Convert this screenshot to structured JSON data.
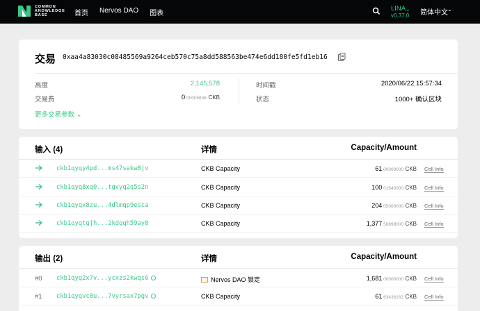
{
  "header": {
    "logo_lines": [
      "COMMON",
      "KNOWLEDGE",
      "BASE"
    ],
    "nav": [
      "首页",
      "Nervos DAO",
      "图表"
    ],
    "chain_name": "LINA",
    "chain_version": "v0.37.0",
    "language": "简体中文"
  },
  "transaction": {
    "title": "交易",
    "hash": "0xaa4a83030c08485569a9264ceb570c75a8dd588563be474e6dd180fe5fd1eb16",
    "height_label": "高度",
    "height_value": "2,145,578",
    "fee_label": "交易费",
    "fee_int": "0",
    "fee_dec": ".00005836",
    "fee_unit": "CKB",
    "timestamp_label": "时间戳",
    "timestamp_value": "2020/06/22 15:57:34",
    "status_label": "状态",
    "status_value": "1000+ 确认区块",
    "more_label": "更多交易参数"
  },
  "inputs": {
    "title": "输入 (4)",
    "detail_header": "详情",
    "amount_header": "Capacity/Amount",
    "rows": [
      {
        "address": "ckb1qyqy4pd...ms47sekw8jv",
        "detail": "CKB Capacity",
        "amount_int": "61",
        "amount_dec": ".00000000",
        "unit": "CKB",
        "cell_info": "Cell Info"
      },
      {
        "address": "ckb1qyq8xq0...tgvyq2q5s2n",
        "detail": "CKB Capacity",
        "amount_int": "100",
        "amount_dec": ".01543000",
        "unit": "CKB",
        "cell_info": "Cell Info"
      },
      {
        "address": "ckb1qyqx8zu...4dlmqp9esca",
        "detail": "CKB Capacity",
        "amount_int": "204",
        "amount_dec": ".05000000",
        "unit": "CKB",
        "cell_info": "Cell Info"
      },
      {
        "address": "ckb1qyqtgjh...2kdqqh59ay8",
        "detail": "CKB Capacity",
        "amount_int": "1,377",
        "amount_dec": ".56899000",
        "unit": "CKB",
        "cell_info": "Cell Info"
      }
    ]
  },
  "outputs": {
    "title": "输出 (2)",
    "detail_header": "详情",
    "amount_header": "Capacity/Amount",
    "rows": [
      {
        "index": "#0",
        "address": "ckb1qyq2x7v...ycxzs2kwqs6",
        "detail": "Nervos DAO 锁定",
        "amount_int": "1,681",
        "amount_dec": ".00000000",
        "unit": "CKB",
        "cell_info": "Cell Info"
      },
      {
        "index": "#1",
        "address": "ckb1qyqvc0u...7vyrsax7pgv",
        "detail": "CKB Capacity",
        "amount_int": "61",
        "amount_dec": ".63436162",
        "unit": "CKB",
        "cell_info": "Cell Info"
      }
    ]
  },
  "colors": {
    "accent": "#3cc68a",
    "topbar": "#040607",
    "background": "#ededed"
  }
}
